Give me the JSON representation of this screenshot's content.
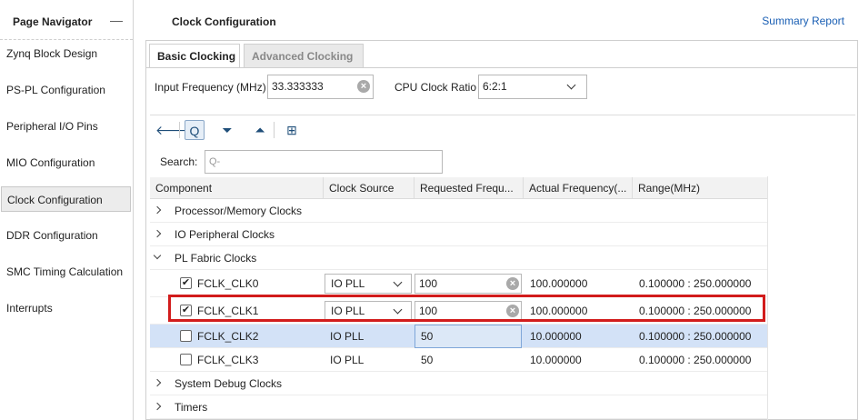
{
  "navigator": {
    "title": "Page Navigator",
    "minimize_glyph": "—",
    "items": [
      {
        "label": "Zynq Block Design"
      },
      {
        "label": "PS-PL Configuration"
      },
      {
        "label": "Peripheral I/O Pins"
      },
      {
        "label": "MIO Configuration"
      },
      {
        "label": "Clock Configuration",
        "selected": true
      },
      {
        "label": "DDR Configuration"
      },
      {
        "label": "SMC Timing Calculation"
      },
      {
        "label": "Interrupts"
      }
    ]
  },
  "main": {
    "title": "Clock Configuration",
    "summary_link": "Summary Report",
    "tabs": [
      {
        "label": "Basic Clocking",
        "active": true
      },
      {
        "label": "Advanced Clocking",
        "active": false
      }
    ],
    "input_frequency": {
      "label": "Input Frequency (MHz)",
      "value": "33.333333"
    },
    "cpu_clock_ratio": {
      "label": "CPU Clock Ratio",
      "value": "6:2:1"
    },
    "search": {
      "label": "Search:",
      "placeholder": "Q-"
    },
    "table": {
      "headers": [
        "Component",
        "Clock Source",
        "Requested Frequ...",
        "Actual Frequency(...",
        "Range(MHz)"
      ],
      "groups": {
        "processor_memory": "Processor/Memory Clocks",
        "io_peripheral": "IO Peripheral Clocks",
        "pl_fabric": "PL Fabric Clocks",
        "system_debug": "System Debug Clocks",
        "timers": "Timers"
      },
      "clocks": [
        {
          "name": "FCLK_CLK0",
          "checked": true,
          "source": "IO PLL",
          "requested": "100",
          "actual": "100.000000",
          "range": "0.100000 : 250.000000"
        },
        {
          "name": "FCLK_CLK1",
          "checked": true,
          "source": "IO PLL",
          "requested": "100",
          "actual": "100.000000",
          "range": "0.100000 : 250.000000"
        },
        {
          "name": "FCLK_CLK2",
          "checked": false,
          "source": "IO PLL",
          "requested": "50",
          "actual": "10.000000",
          "range": "0.100000 : 250.000000"
        },
        {
          "name": "FCLK_CLK3",
          "checked": false,
          "source": "IO PLL",
          "requested": "50",
          "actual": "10.000000",
          "range": "0.100000 : 250.000000"
        }
      ]
    }
  },
  "icons": {
    "checkmark": "✔",
    "clear": "×",
    "back": "🡐",
    "search": "Q",
    "collapse_all": "⏷",
    "expand_all": "⏶",
    "hierarchy": "⊞"
  },
  "colors": {
    "highlight_box": "#d21c1c",
    "selected_row": "#d3e2f7",
    "link": "#1a5fb4"
  }
}
